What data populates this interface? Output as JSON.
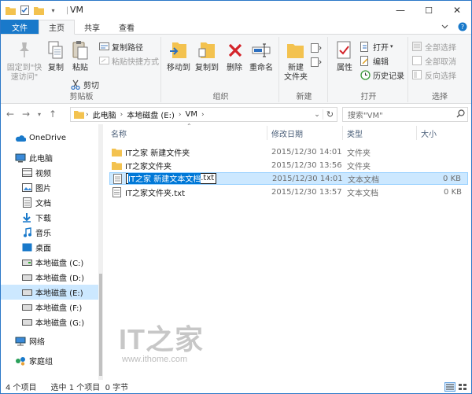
{
  "window": {
    "title": "VM",
    "minimize": "—",
    "maximize": "☐",
    "close": "✕"
  },
  "tabs": [
    {
      "label": "文件"
    },
    {
      "label": "主页"
    },
    {
      "label": "共享"
    },
    {
      "label": "查看"
    }
  ],
  "ribbon": {
    "clipboard": {
      "label": "剪贴板",
      "pin_label_1": "固定到\"快",
      "pin_label_2": "速访问\"",
      "copy": "复制",
      "paste": "粘贴",
      "copy_path": "复制路径",
      "paste_shortcut": "粘贴快捷方式",
      "cut": "剪切"
    },
    "organize": {
      "label": "组织",
      "move_to": "移动到",
      "copy_to": "复制到",
      "delete": "删除",
      "rename": "重命名"
    },
    "new": {
      "label": "新建",
      "new_folder_1": "新建",
      "new_folder_2": "文件夹"
    },
    "open": {
      "label": "打开",
      "properties": "属性",
      "open": "打开",
      "edit": "编辑",
      "history": "历史记录"
    },
    "select": {
      "label": "选择",
      "select_all": "全部选择",
      "select_none": "全部取消",
      "invert": "反向选择"
    }
  },
  "address": {
    "crumbs": [
      "此电脑",
      "本地磁盘 (E:)",
      "VM"
    ],
    "search_placeholder": "搜索\"VM\""
  },
  "navpane": {
    "onedrive": "OneDrive",
    "thispc": "此电脑",
    "videos": "视频",
    "pictures": "图片",
    "documents": "文档",
    "downloads": "下载",
    "music": "音乐",
    "desktop": "桌面",
    "drive_c": "本地磁盘 (C:)",
    "drive_d": "本地磁盘 (D:)",
    "drive_e": "本地磁盘 (E:)",
    "drive_f": "本地磁盘 (F:)",
    "drive_g": "本地磁盘 (G:)",
    "network": "网络",
    "homegroup": "家庭组"
  },
  "columns": {
    "name": "名称",
    "date": "修改日期",
    "type": "类型",
    "size": "大小"
  },
  "files": [
    {
      "name": "IT之家 新建文件夹",
      "date": "2015/12/30 14:01",
      "type": "文件夹",
      "size": ""
    },
    {
      "name": "IT之家文件夹",
      "date": "2015/12/30 13:56",
      "type": "文件夹",
      "size": ""
    },
    {
      "name_selected": "IT之家 新建文本文档",
      "name_ext": ".txt",
      "date": "2015/12/30 14:01",
      "type": "文本文档",
      "size": "0 KB"
    },
    {
      "name": "IT之家文件夹.txt",
      "date": "2015/12/30 13:57",
      "type": "文本文档",
      "size": "0 KB"
    }
  ],
  "watermark": {
    "logo": "IT之家",
    "url": "www.ithome.com"
  },
  "status": {
    "count": "4 个项目",
    "selection": "选中 1 个项目  0 字节"
  },
  "colors": {
    "accent": "#1979ca",
    "selection": "#cce8ff",
    "folder": "#f3c24f"
  }
}
